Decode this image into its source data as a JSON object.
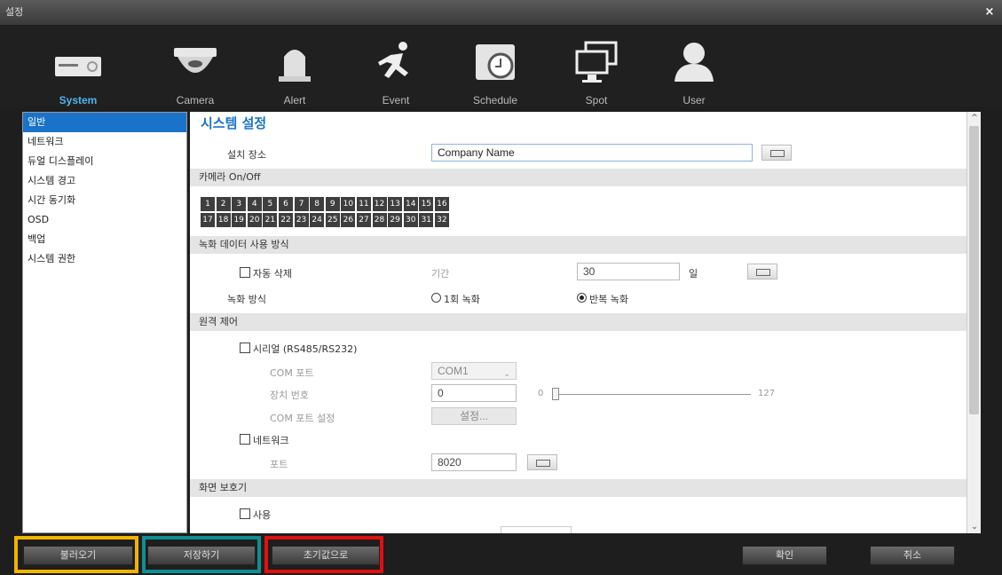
{
  "window": {
    "title": "설정",
    "close_glyph": "×"
  },
  "categories": [
    {
      "label": "System",
      "icon": "system-icon",
      "active": true
    },
    {
      "label": "Camera",
      "icon": "camera-icon"
    },
    {
      "label": "Alert",
      "icon": "alert-icon"
    },
    {
      "label": "Event",
      "icon": "event-icon"
    },
    {
      "label": "Schedule",
      "icon": "schedule-icon"
    },
    {
      "label": "Spot",
      "icon": "spot-icon"
    },
    {
      "label": "User",
      "icon": "user-icon"
    }
  ],
  "sidebar": {
    "items": [
      {
        "label": "일반",
        "active": true
      },
      {
        "label": "네트워크"
      },
      {
        "label": "듀얼 디스플레이"
      },
      {
        "label": "시스템 경고"
      },
      {
        "label": "시간 동기화"
      },
      {
        "label": "OSD"
      },
      {
        "label": "백업"
      },
      {
        "label": "시스템 권한"
      }
    ]
  },
  "main": {
    "title": "시스템 설정",
    "install_location": {
      "label": "설치 장소",
      "value": "Company Name"
    },
    "camera_onoff": {
      "header": "카메라 On/Off",
      "row1": [
        "1",
        "2",
        "3",
        "4",
        "5",
        "6",
        "7",
        "8",
        "9",
        "10",
        "11",
        "12",
        "13",
        "14",
        "15",
        "16"
      ],
      "row2": [
        "17",
        "18",
        "19",
        "20",
        "21",
        "22",
        "23",
        "24",
        "25",
        "26",
        "27",
        "28",
        "29",
        "30",
        "31",
        "32"
      ]
    },
    "recording": {
      "header": "녹화 데이터 사용 방식",
      "auto_delete_label": "자동 삭제",
      "period_label": "기간",
      "period_value": "30",
      "period_unit": "일",
      "method_label": "녹화 방식",
      "option_once": "1회 녹화",
      "option_repeat": "반복 녹화"
    },
    "remote": {
      "header": "원격 제어",
      "serial_label": "시리얼 (RS485/RS232)",
      "com_port_label": "COM 포트",
      "com_port_value": "COM1",
      "device_no_label": "장치 번호",
      "device_no_value": "0",
      "slider_min": "0",
      "slider_max": "127",
      "com_setting_label": "COM 포트 설정",
      "com_setting_button": "설정...",
      "network_label": "네트워크",
      "port_label": "포트",
      "port_value": "8020"
    },
    "screensaver": {
      "header": "화면 보호기",
      "use_label": "사용"
    }
  },
  "footer": {
    "load": "불러오기",
    "save": "저장하기",
    "reset": "초기값으로",
    "ok": "확인",
    "cancel": "취소"
  },
  "highlight_colors": {
    "load": "#f0b400",
    "save": "#0f8f8f",
    "reset": "#e01010"
  }
}
